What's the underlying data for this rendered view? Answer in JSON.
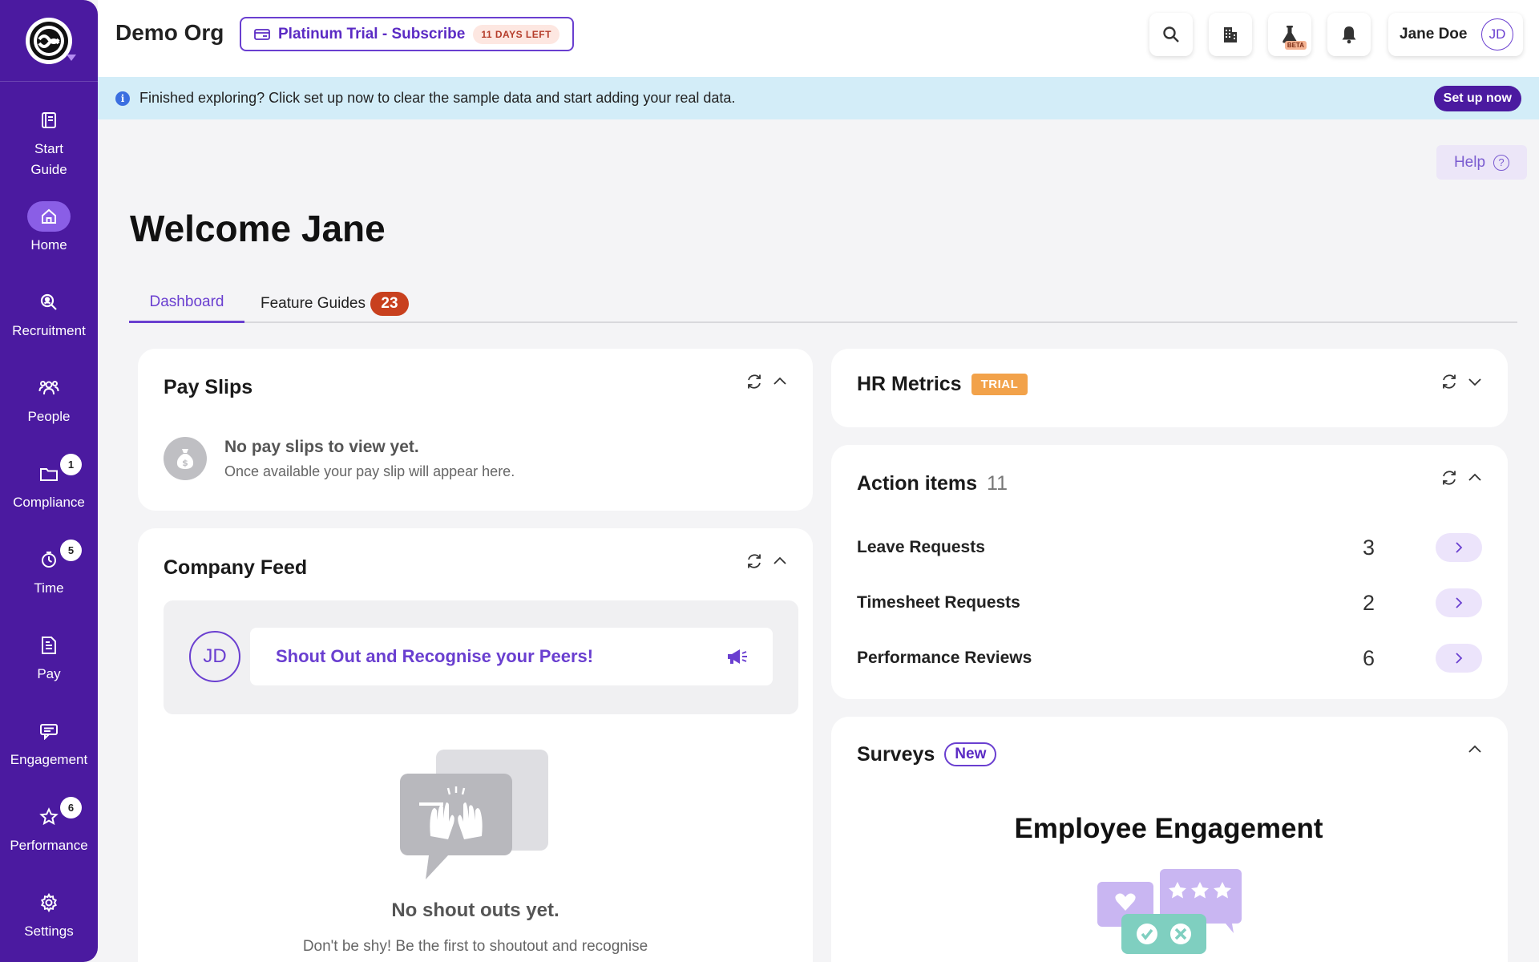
{
  "sidebar": {
    "items": [
      {
        "label": "Start\nGuide",
        "icon": "book-icon"
      },
      {
        "label": "Home",
        "icon": "home-icon",
        "active": true
      },
      {
        "label": "Recruitment",
        "icon": "search-person-icon"
      },
      {
        "label": "People",
        "icon": "people-icon"
      },
      {
        "label": "Compliance",
        "icon": "folder-icon",
        "badge": "1"
      },
      {
        "label": "Time",
        "icon": "time-icon",
        "badge": "5"
      },
      {
        "label": "Pay",
        "icon": "pay-icon"
      },
      {
        "label": "Engagement",
        "icon": "chat-icon"
      },
      {
        "label": "Performance",
        "icon": "star-icon",
        "badge": "6"
      },
      {
        "label": "Settings",
        "icon": "gear-icon"
      }
    ]
  },
  "header": {
    "org_name": "Demo Org",
    "trial_label": "Platinum Trial - Subscribe",
    "days_left": "11 DAYS LEFT",
    "beta": "BETA",
    "user_name": "Jane Doe",
    "user_initials": "JD"
  },
  "banner": {
    "text": "Finished exploring? Click set up now to clear the sample data and start adding your real data.",
    "button": "Set up now"
  },
  "help": {
    "label": "Help"
  },
  "welcome": "Welcome Jane",
  "tabs": [
    {
      "label": "Dashboard",
      "active": true
    },
    {
      "label": "Feature Guides",
      "count": "23"
    }
  ],
  "pay_slips": {
    "title": "Pay Slips",
    "empty_title": "No pay slips to view yet.",
    "empty_sub": "Once available your pay slip will appear here."
  },
  "company_feed": {
    "title": "Company Feed",
    "avatar_initials": "JD",
    "shout_prompt": "Shout Out and Recognise your Peers!",
    "empty_title": "No shout outs yet.",
    "empty_sub": "Don't be shy! Be the first to shoutout and recognise"
  },
  "hr_metrics": {
    "title": "HR Metrics",
    "tag": "TRIAL"
  },
  "action_items": {
    "title": "Action items",
    "count": "11",
    "rows": [
      {
        "label": "Leave Requests",
        "count": "3"
      },
      {
        "label": "Timesheet Requests",
        "count": "2"
      },
      {
        "label": "Performance Reviews",
        "count": "6"
      }
    ]
  },
  "surveys": {
    "title": "Surveys",
    "tag": "New",
    "heading": "Employee Engagement"
  },
  "colors": {
    "brand": "#4b1aa0",
    "accent": "#6a3fd0",
    "banner": "#d3edf8",
    "trial": "#f2a24a",
    "alert": "#c8401e"
  }
}
